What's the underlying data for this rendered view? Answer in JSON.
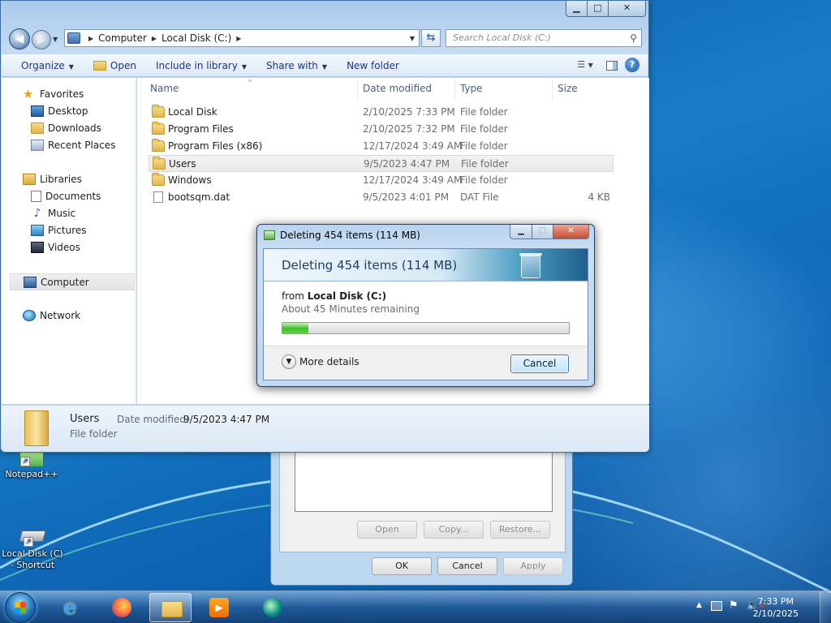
{
  "desktop": {
    "icons": [
      {
        "label": "Notepad++"
      },
      {
        "label": "Local Disk (C) - Shortcut"
      }
    ]
  },
  "back_dialog": {
    "buttons": {
      "open": "Open",
      "copy": "Copy...",
      "restore": "Restore...",
      "ok": "OK",
      "cancel": "Cancel",
      "apply": "Apply"
    }
  },
  "explorer": {
    "window_controls": {
      "minimize": "▁",
      "maximize": "□",
      "close": "✕"
    },
    "breadcrumb": [
      "Computer",
      "Local Disk (C:)"
    ],
    "search_placeholder": "Search Local Disk (C:)",
    "toolbar": {
      "organize": "Organize",
      "open": "Open",
      "include": "Include in library",
      "share": "Share with",
      "new_folder": "New folder"
    },
    "nav": {
      "favorites": "Favorites",
      "desktop": "Desktop",
      "downloads": "Downloads",
      "recent": "Recent Places",
      "libraries": "Libraries",
      "documents": "Documents",
      "music": "Music",
      "pictures": "Pictures",
      "videos": "Videos",
      "computer": "Computer",
      "network": "Network"
    },
    "columns": {
      "name": "Name",
      "date": "Date modified",
      "type": "Type",
      "size": "Size"
    },
    "files": [
      {
        "name": "Local Disk",
        "date": "2/10/2025 7:33 PM",
        "type": "File folder",
        "size": "",
        "kind": "folder"
      },
      {
        "name": "Program Files",
        "date": "2/10/2025 7:32 PM",
        "type": "File folder",
        "size": "",
        "kind": "folder"
      },
      {
        "name": "Program Files (x86)",
        "date": "12/17/2024 3:49 AM",
        "type": "File folder",
        "size": "",
        "kind": "folder"
      },
      {
        "name": "Users",
        "date": "9/5/2023 4:47 PM",
        "type": "File folder",
        "size": "",
        "kind": "folder"
      },
      {
        "name": "Windows",
        "date": "12/17/2024 3:49 AM",
        "type": "File folder",
        "size": "",
        "kind": "folder"
      },
      {
        "name": "bootsqm.dat",
        "date": "9/5/2023 4:01 PM",
        "type": "DAT File",
        "size": "4 KB",
        "kind": "file"
      }
    ],
    "details": {
      "name": "Users",
      "date_label": "Date modified:",
      "date": "9/5/2023 4:47 PM",
      "type": "File folder"
    }
  },
  "progress_dialog": {
    "title": "Deleting 454 items (114 MB)",
    "heading": "Deleting 454 items (114 MB)",
    "from_label": "from",
    "from_location": "Local Disk (C:)",
    "remaining": "About 45 Minutes remaining",
    "progress_fraction": 0.09,
    "more_details": "More details",
    "cancel": "Cancel"
  },
  "taskbar": {
    "time": "7:33 PM",
    "date": "2/10/2025",
    "apps": [
      "windows-explorer-ie",
      "firefox",
      "file-explorer",
      "media-player",
      "app-green-circle"
    ]
  }
}
